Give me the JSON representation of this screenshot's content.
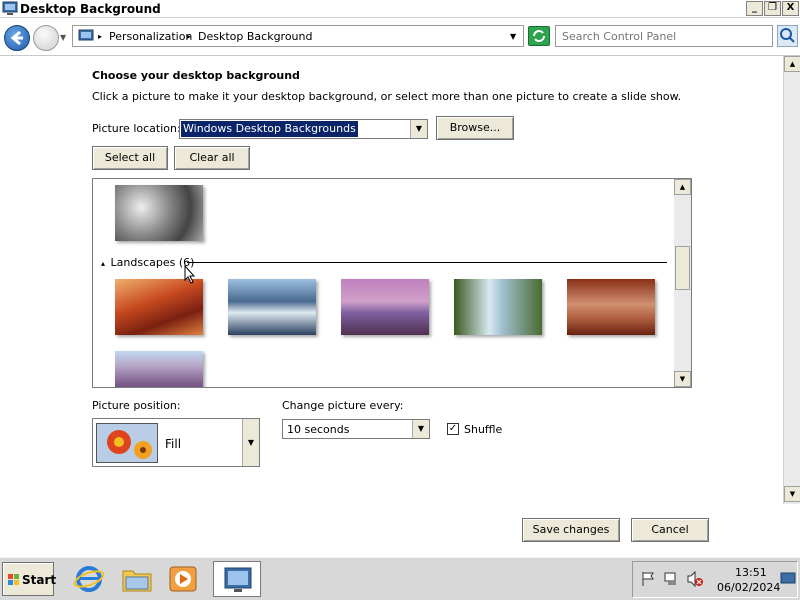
{
  "window": {
    "title": "Desktop Background",
    "controls": {
      "minimize": "_",
      "maximize": "❐",
      "close": "X"
    }
  },
  "address": {
    "crumbs": [
      "Personalization",
      "Desktop Background"
    ],
    "separator": "▸",
    "search_placeholder": "Search Control Panel"
  },
  "main": {
    "heading": "Choose your desktop background",
    "subtext": "Click a picture to make it your desktop background, or select more than one picture to create a slide show.",
    "picture_location_label": "Picture location:",
    "picture_location_value": "Windows Desktop Backgrounds",
    "browse_label": "Browse...",
    "select_all_label": "Select all",
    "clear_all_label": "Clear all",
    "group_title": "Landscapes (6)",
    "group_collapse_glyph": "▴",
    "picture_position_label": "Picture position:",
    "picture_position_value": "Fill",
    "change_every_label": "Change picture every:",
    "change_every_value": "10 seconds",
    "shuffle_label": "Shuffle",
    "shuffle_checked": true,
    "save_label": "Save changes",
    "cancel_label": "Cancel"
  },
  "taskbar": {
    "start_label": "Start",
    "time": "13:51",
    "date": "06/02/2024"
  },
  "colors": {
    "selection": "#0a246a",
    "button_face": "#ece9d8",
    "taskbar": "#d8d8d8"
  }
}
